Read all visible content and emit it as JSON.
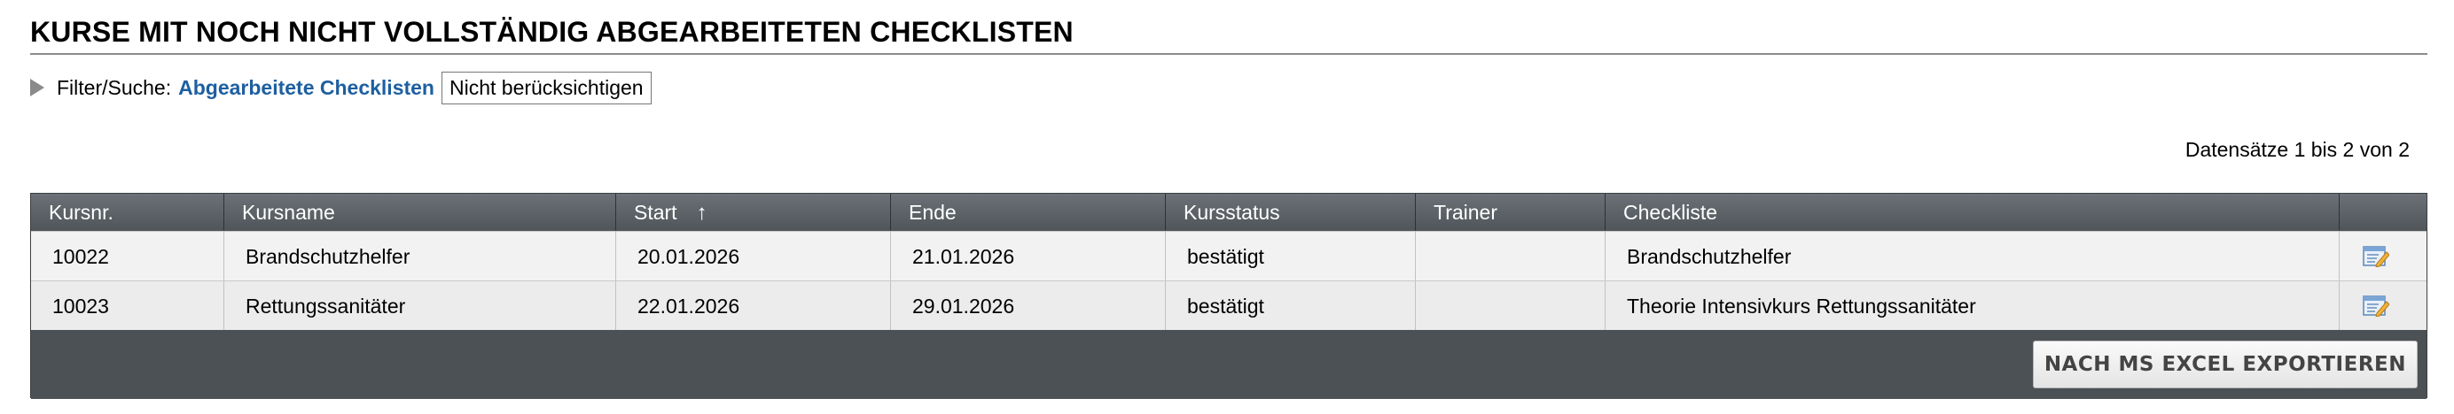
{
  "page": {
    "title": "KURSE MIT NOCH NICHT VOLLSTÄNDIG ABGEARBEITETEN CHECKLISTEN"
  },
  "filter": {
    "label": "Filter/Suche:",
    "link": "Abgearbeitete Checklisten",
    "button": "Nicht berücksichtigen"
  },
  "records_info": "Datensätze 1 bis 2 von 2",
  "table": {
    "columns": {
      "kursnr": "Kursnr.",
      "kursname": "Kursname",
      "start": "Start",
      "start_sort": "↑",
      "ende": "Ende",
      "kursstatus": "Kursstatus",
      "trainer": "Trainer",
      "checkliste": "Checkliste"
    },
    "rows": [
      {
        "kursnr": "10022",
        "kursname": "Brandschutzhelfer",
        "start": "20.01.2026",
        "ende": "21.01.2026",
        "kursstatus": "bestätigt",
        "trainer": "",
        "checkliste": "Brandschutzhelfer",
        "action_icon": "edit-checklist-icon"
      },
      {
        "kursnr": "10023",
        "kursname": "Rettungssanitäter",
        "start": "22.01.2026",
        "ende": "29.01.2026",
        "kursstatus": "bestätigt",
        "trainer": "",
        "checkliste": "Theorie Intensivkurs Rettungssanitäter",
        "action_icon": "edit-checklist-icon"
      }
    ]
  },
  "export_button": "NACH MS EXCEL EXPORTIEREN",
  "colors": {
    "link": "#1d5fa0",
    "grid_header": "#4f5559",
    "row_bg": "#f2f2f2"
  }
}
